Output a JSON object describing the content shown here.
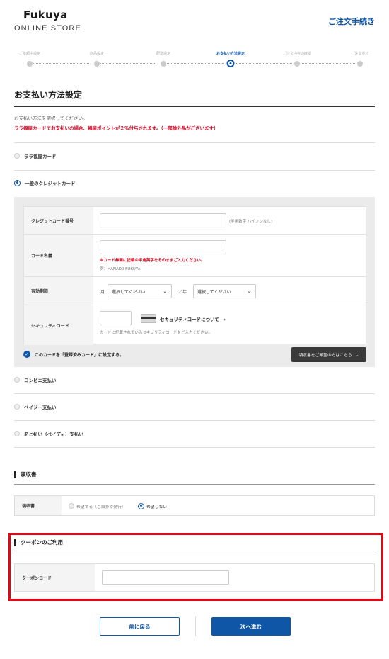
{
  "header": {
    "logo_main": "Fukuya",
    "logo_sub": "ONLINE STORE",
    "procedure_link": "ご注文手続き"
  },
  "stepper": {
    "steps": [
      {
        "label": "ご依頼主設定",
        "active": false
      },
      {
        "label": "商品設定",
        "active": false
      },
      {
        "label": "配送設定",
        "active": false
      },
      {
        "label": "お支払い方法設定",
        "active": true
      },
      {
        "label": "ご注文内容の確認",
        "active": false
      },
      {
        "label": "ご注文完了",
        "active": false
      }
    ]
  },
  "page": {
    "title": "お支払い方法設定",
    "notice": "お支払い方法を選択してください。",
    "notice_red": "ララ福屋カードでお支払いの場合、福屋ポイントが２％付与されます。（一部除外品がございます）"
  },
  "payment_options": {
    "lala_card": "ララ福屋カード",
    "credit_card": "一般のクレジットカード",
    "convenience": "コンビニ支払い",
    "payeasy": "ペイジー支払い",
    "paidy": "あと払い（ペイディ）支払い"
  },
  "card_form": {
    "number_label": "クレジットカード番号",
    "number_value": "",
    "number_hint": "(半角数字 ハイフンなし)",
    "name_label": "カード名義",
    "name_value": "",
    "name_warning": "※カード券面に記載の半角英字をそのままご入力ください。",
    "name_example": "例：HANAKO FUKUYA",
    "expiry_label": "有効期限",
    "month_label": "月",
    "month_value": "選択してください",
    "year_label": "／年",
    "year_value": "選択してください",
    "security_label": "セキュリティコード",
    "security_value": "",
    "security_link": "セキュリティコードについて",
    "security_hint": "カードに記載されているセキュリティコードをご入力ください。"
  },
  "register_card_label": "このカードを「登録済みカード」に設定する。",
  "receipt_request_button": "領収書をご希望の方はこちら",
  "receipt": {
    "section_title": "領収書",
    "row_label": "領収書",
    "option_yes": "希望する（ご自身で発行）",
    "option_no": "希望しない",
    "selected": "希望しない"
  },
  "coupon": {
    "section_title": "クーポンのご利用",
    "row_label": "クーポンコード",
    "value": ""
  },
  "footer": {
    "back_button": "前に戻る",
    "next_button": "次へ進む"
  },
  "colors": {
    "accent": "#0f56a7",
    "alert": "#d1021d",
    "highlight_frame": "#e30613"
  }
}
